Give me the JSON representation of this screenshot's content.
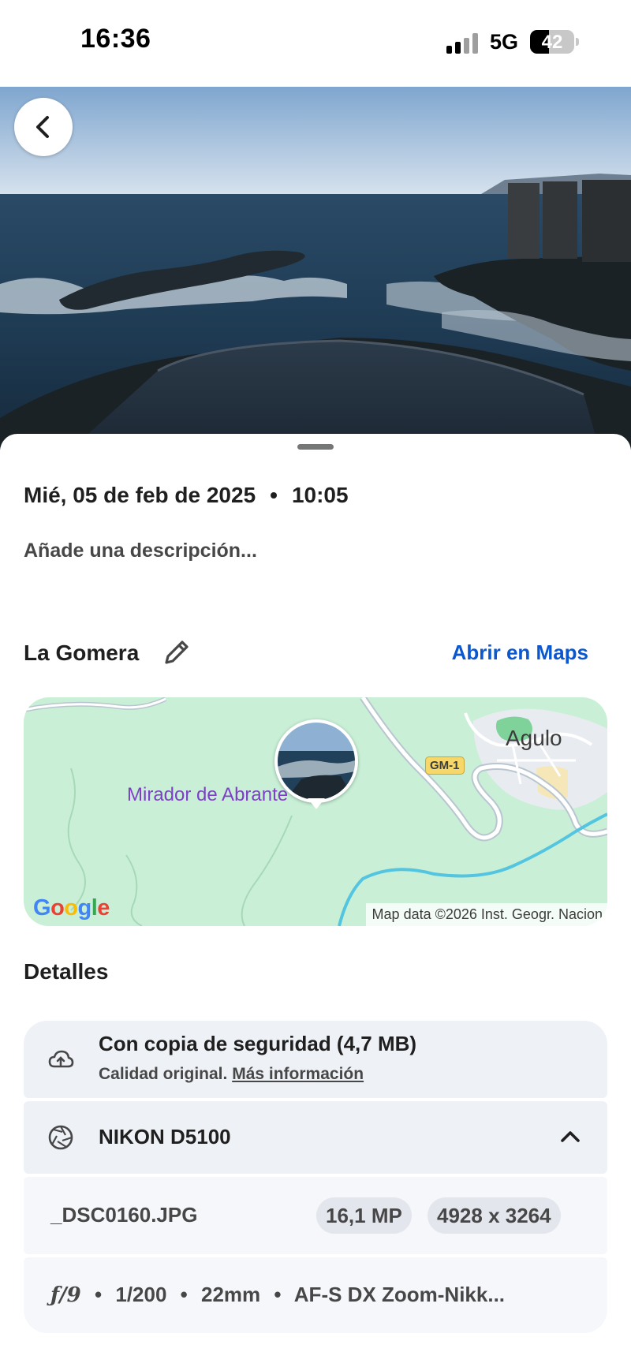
{
  "status_bar": {
    "time": "16:36",
    "network": "5G",
    "battery": "42",
    "battery_level_percent": 42
  },
  "photo": {
    "back_icon": "chevron-left-icon"
  },
  "info": {
    "date": "Mié, 05 de feb de 2025",
    "separator": "•",
    "time": "10:05",
    "description_placeholder": "Añade una descripción..."
  },
  "location": {
    "name": "La Gomera",
    "edit_icon": "pencil-icon",
    "open_maps_label": "Abrir en Maps"
  },
  "map": {
    "place_label": "Mirador de Abrante",
    "town_label": "Agulo",
    "road_label": "GM-1",
    "provider": "Google",
    "attribution": "Map data ©2026 Inst. Geogr. Nacion"
  },
  "details": {
    "title": "Detalles",
    "backup": {
      "icon": "cloud-check-icon",
      "title": "Con copia de seguridad (4,7 MB)",
      "subtitle": "Calidad original.",
      "more_link": "Más información"
    },
    "camera": {
      "icon": "camera-aperture-icon",
      "model": "NIKON D5100",
      "toggle_icon": "chevron-up-icon"
    },
    "file": {
      "name": "_DSC0160.JPG",
      "megapixels": "16,1 MP",
      "dimensions": "4928 x 3264"
    },
    "exif": {
      "aperture": "ƒ/9",
      "shutter": "1/200",
      "focal_length": "22mm",
      "lens": "AF-S DX Zoom-Nikk...",
      "separator": "•"
    }
  },
  "colors": {
    "accent_link": "#0b57d0",
    "card_background": "#eef1f6",
    "map_green": "#c9f0d7",
    "place_purple": "#7e3fc8"
  }
}
